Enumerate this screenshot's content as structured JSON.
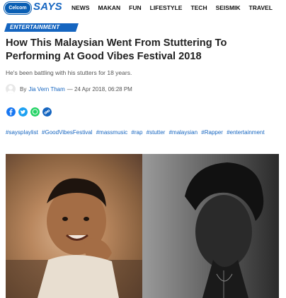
{
  "header": {
    "logo_small": "Celcom",
    "logo_brand": "SAYS",
    "nav_items": [
      "NEWS",
      "MAKAN",
      "FUN",
      "LIFESTYLE",
      "TECH",
      "SEISMIK",
      "TRAVEL"
    ]
  },
  "article": {
    "category": "ENTERTAINMENT",
    "title": "How This Malaysian Went From Stuttering To Performing At Good Vibes Festival 2018",
    "subtitle": "He's been battling with his stutters for 18 years.",
    "by_label": "By",
    "author": "Jia Vern Tham",
    "date": "— 24 Apr 2018, 06:28 PM",
    "tags": [
      "#sayspIaylist",
      "#GoodVibesFestival",
      "#massmusic",
      "#rap",
      "#stutter",
      "#malaysian",
      "#Rapper",
      "#entertainment"
    ]
  },
  "share": [
    "facebook-icon",
    "twitter-icon",
    "whatsapp-icon",
    "link-icon"
  ],
  "colors": {
    "brand": "#1565c0",
    "facebook": "#1877f2",
    "twitter": "#1da1f2",
    "whatsapp": "#25d366",
    "link": "#1565c0"
  }
}
